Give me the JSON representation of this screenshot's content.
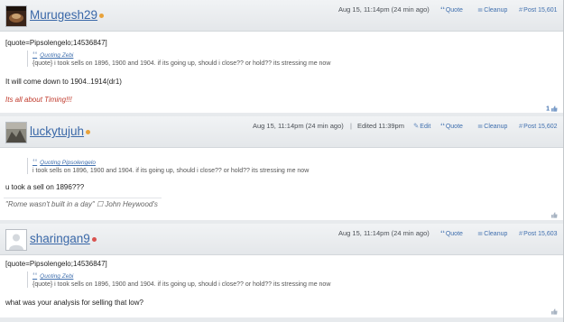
{
  "posts": [
    {
      "username": "Murugesh29",
      "online_color": "#e8a23a",
      "timestamp": "Aug 15, 11:14pm (24 min ago)",
      "edited": "",
      "actions": {
        "quote": "Quote",
        "cleanup": "Cleanup",
        "post_no": "Post 15,601"
      },
      "quote_raw": "[quote=Pipsolengelo;14536847]",
      "quote_by": "Quoting Zebi",
      "quote_text": "{quote} i took sells on 1896, 1900 and 1904. if its going up, should i close?? or hold?? its stressing me now",
      "body": "It will come down to 1904..1914(dr1)",
      "signature": "Its all about Timing!!!",
      "signature_color": "#c0392b",
      "likes": "1"
    },
    {
      "username": "luckytujuh",
      "online_color": "#e8a23a",
      "timestamp": "Aug 15, 11:14pm (24 min ago)",
      "edited": "Edited 11:39pm",
      "actions": {
        "edit": "Edit",
        "quote": "Quote",
        "cleanup": "Cleanup",
        "post_no": "Post 15,602"
      },
      "quote_by": "Quoting Pipsolengelo",
      "quote_text": "i took sells on 1896, 1900 and 1904. if its going up, should i close?? or hold?? its stressing me now",
      "body": "u took a sell on 1896???",
      "signature": "\"Rome wasn't built in a day\" ☐ John Heywood's",
      "signature_color": "#666666"
    },
    {
      "username": "sharingan9",
      "online_color": "#d9534f",
      "timestamp": "Aug 15, 11:14pm (24 min ago)",
      "edited": "",
      "actions": {
        "quote": "Quote",
        "cleanup": "Cleanup",
        "post_no": "Post 15,603"
      },
      "quote_raw": "[quote=Pipsolengelo;14536847]",
      "quote_by": "Quoting Zebi",
      "quote_text": "{quote} i took sells on 1896, 1900 and 1904. if its going up, should i close?? or hold?? its stressing me now",
      "body": "what was your analysis for selling that low?"
    }
  ],
  "icons": {
    "quote": "quote-icon",
    "cleanup": "cleanup-icon",
    "permalink": "permalink-icon",
    "edit": "edit-icon",
    "like": "thumbs-up-icon"
  },
  "colors": {
    "link": "#3f6fae",
    "username": "#3a68a8"
  }
}
